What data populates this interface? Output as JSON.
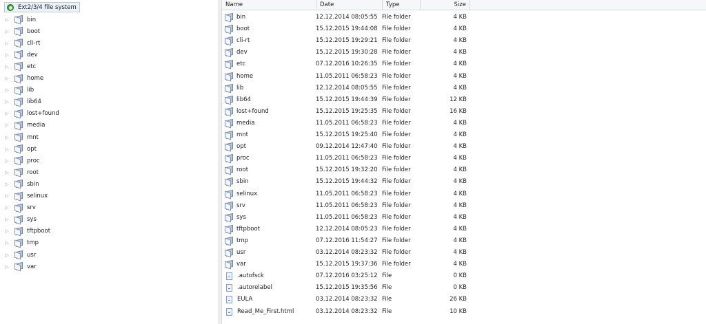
{
  "tree": {
    "root_label": "Ext2/3/4 file system",
    "items": [
      "bin",
      "boot",
      "cli-rt",
      "dev",
      "etc",
      "home",
      "lib",
      "lib64",
      "lost+found",
      "media",
      "mnt",
      "opt",
      "proc",
      "root",
      "sbin",
      "selinux",
      "srv",
      "sys",
      "tftpboot",
      "tmp",
      "usr",
      "var"
    ]
  },
  "columns": {
    "name": "Name",
    "date": "Date",
    "type": "Type",
    "size": "Size"
  },
  "rows": [
    {
      "icon": "folder-icon",
      "name": "bin",
      "date": "12.12.2014 08:05:55",
      "type": "File folder",
      "size": "4 KB"
    },
    {
      "icon": "folder-icon",
      "name": "boot",
      "date": "15.12.2015 19:44:08",
      "type": "File folder",
      "size": "4 KB"
    },
    {
      "icon": "folder-icon",
      "name": "cli-rt",
      "date": "15.12.2015 19:29:21",
      "type": "File folder",
      "size": "4 KB"
    },
    {
      "icon": "folder-icon",
      "name": "dev",
      "date": "15.12.2015 19:30:28",
      "type": "File folder",
      "size": "4 KB"
    },
    {
      "icon": "folder-icon",
      "name": "etc",
      "date": "07.12.2016 10:26:35",
      "type": "File folder",
      "size": "4 KB"
    },
    {
      "icon": "folder-icon",
      "name": "home",
      "date": "11.05.2011 06:58:23",
      "type": "File folder",
      "size": "4 KB"
    },
    {
      "icon": "folder-icon",
      "name": "lib",
      "date": "12.12.2014 08:05:55",
      "type": "File folder",
      "size": "4 KB"
    },
    {
      "icon": "folder-icon",
      "name": "lib64",
      "date": "15.12.2015 19:44:39",
      "type": "File folder",
      "size": "12 KB"
    },
    {
      "icon": "folder-icon",
      "name": "lost+found",
      "date": "15.12.2015 19:25:35",
      "type": "File folder",
      "size": "16 KB"
    },
    {
      "icon": "folder-icon",
      "name": "media",
      "date": "11.05.2011 06:58:23",
      "type": "File folder",
      "size": "4 KB"
    },
    {
      "icon": "folder-icon",
      "name": "mnt",
      "date": "15.12.2015 19:25:40",
      "type": "File folder",
      "size": "4 KB"
    },
    {
      "icon": "folder-icon",
      "name": "opt",
      "date": "09.12.2014 12:47:40",
      "type": "File folder",
      "size": "4 KB"
    },
    {
      "icon": "folder-icon",
      "name": "proc",
      "date": "11.05.2011 06:58:23",
      "type": "File folder",
      "size": "4 KB"
    },
    {
      "icon": "folder-icon",
      "name": "root",
      "date": "15.12.2015 19:32:20",
      "type": "File folder",
      "size": "4 KB"
    },
    {
      "icon": "folder-icon",
      "name": "sbin",
      "date": "15.12.2015 19:44:32",
      "type": "File folder",
      "size": "4 KB"
    },
    {
      "icon": "folder-icon",
      "name": "selinux",
      "date": "11.05.2011 06:58:23",
      "type": "File folder",
      "size": "4 KB"
    },
    {
      "icon": "folder-icon",
      "name": "srv",
      "date": "11.05.2011 06:58:23",
      "type": "File folder",
      "size": "4 KB"
    },
    {
      "icon": "folder-icon",
      "name": "sys",
      "date": "11.05.2011 06:58:23",
      "type": "File folder",
      "size": "4 KB"
    },
    {
      "icon": "folder-icon",
      "name": "tftpboot",
      "date": "12.12.2014 08:05:23",
      "type": "File folder",
      "size": "4 KB"
    },
    {
      "icon": "folder-icon",
      "name": "tmp",
      "date": "07.12.2016 11:54:27",
      "type": "File folder",
      "size": "4 KB"
    },
    {
      "icon": "folder-icon",
      "name": "usr",
      "date": "03.12.2014 08:23:32",
      "type": "File folder",
      "size": "4 KB"
    },
    {
      "icon": "folder-icon",
      "name": "var",
      "date": "15.12.2015 19:37:36",
      "type": "File folder",
      "size": "4 KB"
    },
    {
      "icon": "file-icon",
      "name": ".autofsck",
      "date": "07.12.2016 03:25:12",
      "type": "File",
      "size": "0 KB"
    },
    {
      "icon": "file-icon",
      "name": ".autorelabel",
      "date": "15.12.2015 19:35:56",
      "type": "File",
      "size": "0 KB"
    },
    {
      "icon": "file-icon",
      "name": "EULA",
      "date": "03.12.2014 08:23:32",
      "type": "File",
      "size": "26 KB"
    },
    {
      "icon": "file-icon",
      "name": "Read_Me_First.html",
      "date": "03.12.2014 08:23:32",
      "type": "File",
      "size": "10 KB"
    }
  ]
}
